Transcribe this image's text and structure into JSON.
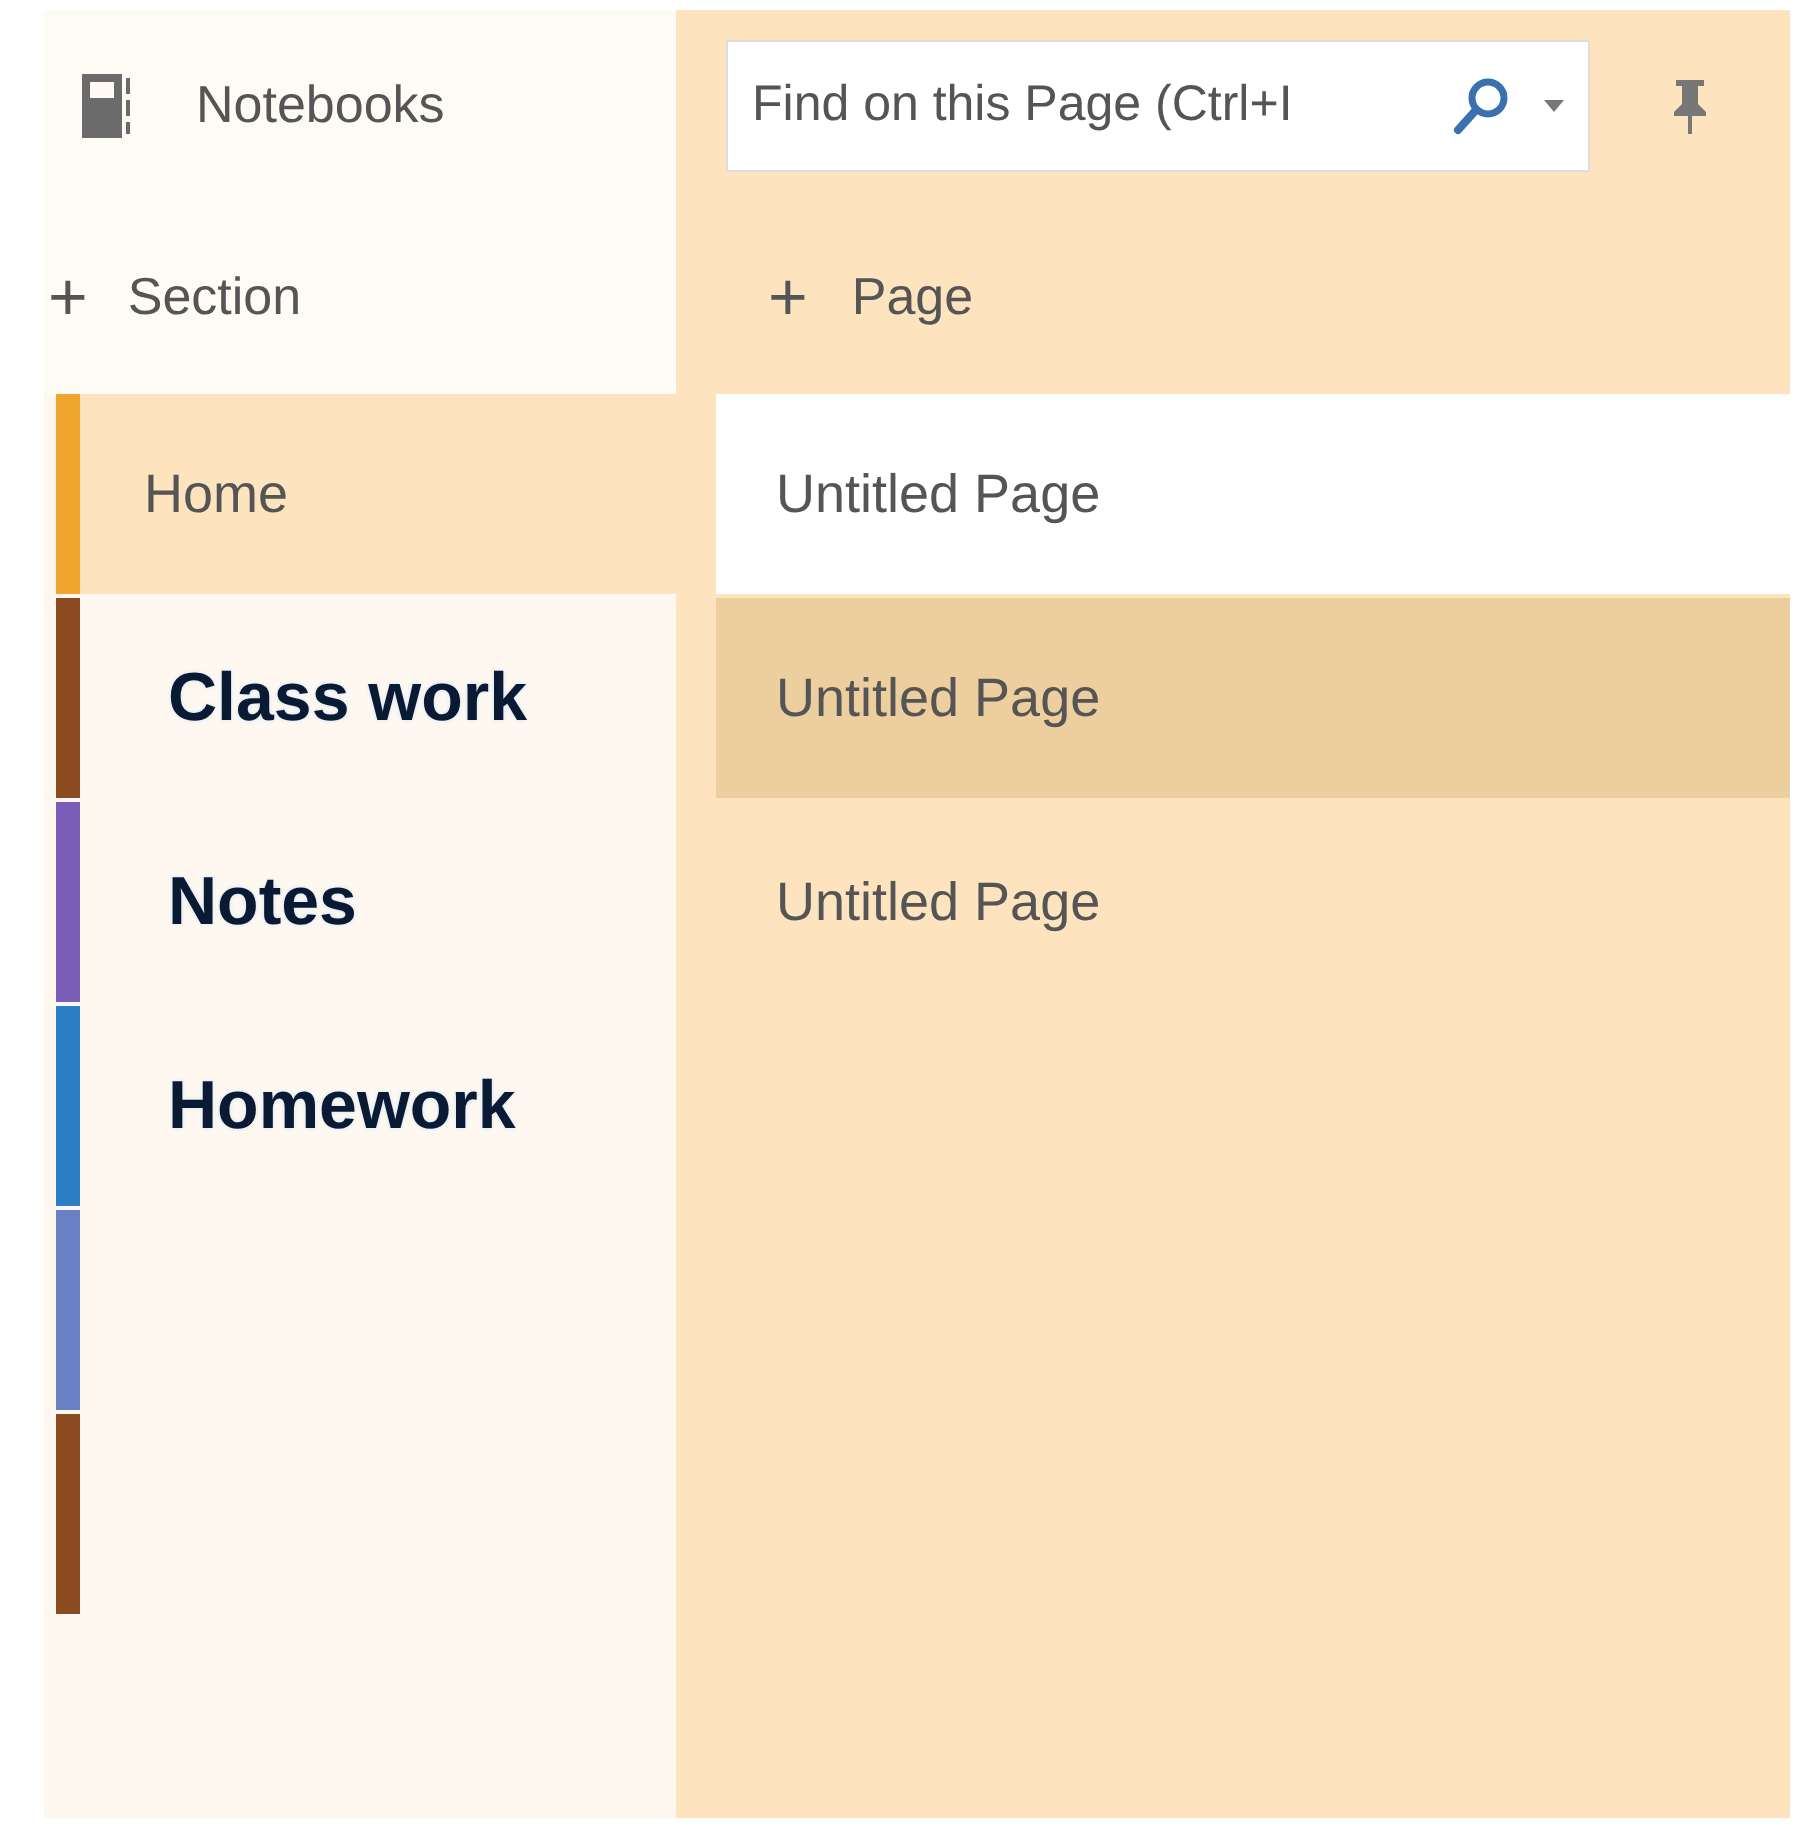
{
  "notebooks": {
    "label": "Notebooks"
  },
  "add_section": {
    "icon": "+",
    "label": "Section"
  },
  "sections": [
    {
      "kind": "plain",
      "label": "Home",
      "color": "#f0a52c",
      "selected": true
    },
    {
      "kind": "annotated",
      "label": "Class work",
      "color": "#8b4a1f",
      "selected": false
    },
    {
      "kind": "annotated",
      "label": "Notes",
      "color": "#7a5db8",
      "selected": false
    },
    {
      "kind": "annotated",
      "label": "Homework",
      "color": "#2a7fc4",
      "selected": false
    },
    {
      "kind": "plain",
      "color": "#6a80c4",
      "selected": false
    },
    {
      "kind": "plain",
      "color": "#8b4a1f",
      "selected": false
    }
  ],
  "search": {
    "placeholder": "Find on this Page (Ctrl+I"
  },
  "add_page": {
    "icon": "+",
    "label": "Page"
  },
  "pages": [
    {
      "label": "Untitled Page",
      "selected": true,
      "hovered": false
    },
    {
      "label": "Untitled Page",
      "selected": false,
      "hovered": true
    },
    {
      "label": "Untitled Page",
      "selected": false,
      "hovered": false
    }
  ]
}
